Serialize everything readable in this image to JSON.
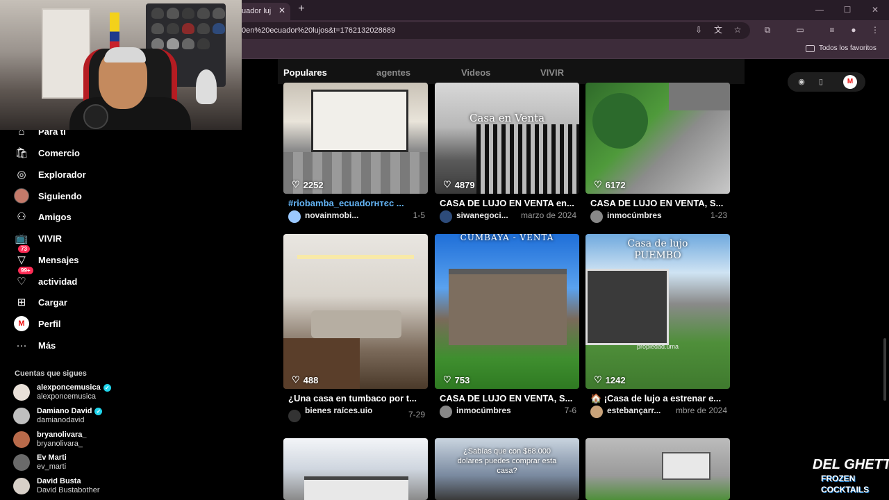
{
  "browser": {
    "tab_title": "uador luj",
    "url": "0en%20ecuador%20lujos&t=1762132028689",
    "bookmark_folder": "Todos los favoritos"
  },
  "sidebar": {
    "items": [
      {
        "label": "Para ti",
        "icon": "home-icon"
      },
      {
        "label": "Comercio",
        "icon": "shop-icon"
      },
      {
        "label": "Explorador",
        "icon": "compass-icon"
      },
      {
        "label": "Siguiendo",
        "icon": "following-avatar"
      },
      {
        "label": "Amigos",
        "icon": "friends-icon"
      },
      {
        "label": "VIVIR",
        "icon": "live-icon"
      },
      {
        "label": "Mensajes",
        "icon": "messages-icon",
        "badge": "73"
      },
      {
        "label": "actividad",
        "icon": "activity-icon",
        "badge": "99+"
      },
      {
        "label": "Cargar",
        "icon": "upload-icon"
      },
      {
        "label": "Perfil",
        "icon": "profile-avatar"
      },
      {
        "label": "Más",
        "icon": "more-icon"
      }
    ],
    "following_header": "Cuentas que sigues",
    "following": [
      {
        "name": "alexponcemusica",
        "handle": "alexponcemusica",
        "verified": true
      },
      {
        "name": "Damiano David",
        "handle": "damianodavid",
        "verified": true
      },
      {
        "name": "bryanolivara_",
        "handle": "bryanolivara_",
        "verified": false
      },
      {
        "name": "Ev Marti",
        "handle": "ev_marti",
        "verified": false
      },
      {
        "name": "David Busta",
        "handle": "David Bustabother",
        "verified": false
      }
    ]
  },
  "tabs": [
    "Populares",
    "agentes",
    "Videos",
    "VIVIR"
  ],
  "profile_initial": "M",
  "videos": [
    {
      "likes": "2252",
      "caption": "#riobamba_ecuadorнтєc ...",
      "author": "novainmobi...",
      "date": "1-5",
      "caption_link": true
    },
    {
      "likes": "4879",
      "caption": "CASA DE LUJO EN VENTA en...",
      "author": "siwanegoci...",
      "date": "marzo de 2024",
      "overlay": "Casa en Venta"
    },
    {
      "likes": "6172",
      "caption": "CASA DE LUJO EN VENTA, S...",
      "author": "inmocúmbres",
      "date": "1-23"
    },
    {
      "likes": "488",
      "caption": "¿Una casa en tumbaco por t...",
      "author": "bienes raíces.uio",
      "date": "7-29"
    },
    {
      "likes": "753",
      "caption": "CASA DE LUJO EN VENTA, S...",
      "author": "inmocúmbres",
      "date": "7-6",
      "overlay": "CUMBAYÁ - VENTA"
    },
    {
      "likes": "1242",
      "caption": "🏠 ¡Casa de lujo a estrenar e...",
      "author": "estebançarr...",
      "date": "mbre de 2024",
      "overlay": "Casa de lujo PUEMBO",
      "watermark": "propiedad.uma"
    },
    {
      "overlay": "¿Sabías que con $68.000 dolares puedes comprar esta casa?"
    }
  ],
  "logo": {
    "line1": "DEL GHETTO",
    "line2": "FROZEN",
    "line3": "COCKTAILS"
  }
}
